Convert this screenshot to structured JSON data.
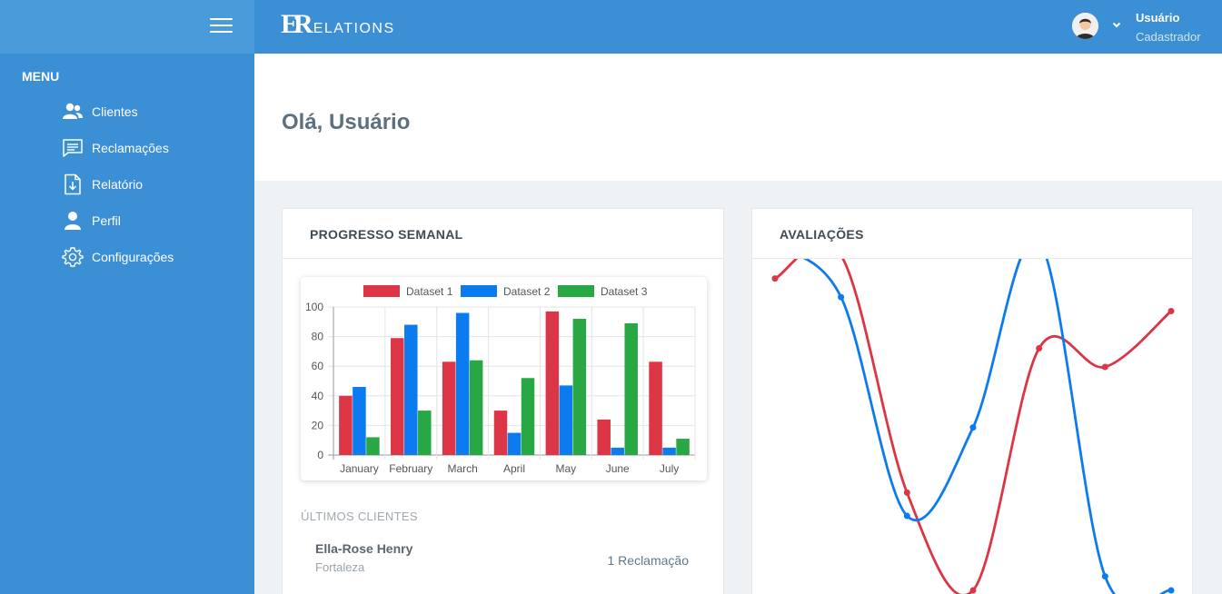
{
  "sidebar": {
    "menu_title": "MENU",
    "items": [
      {
        "label": "Clientes",
        "icon": "users-icon"
      },
      {
        "label": "Reclamações",
        "icon": "message-icon"
      },
      {
        "label": "Relatório",
        "icon": "file-download-icon"
      },
      {
        "label": "Perfil",
        "icon": "user-icon"
      },
      {
        "label": "Configurações",
        "icon": "gear-icon"
      }
    ]
  },
  "header": {
    "logo_mark": "ER",
    "logo_text": "ELATIONS",
    "user_name": "Usuário",
    "user_role": "Cadastrador"
  },
  "greeting": "Olá, Usuário",
  "weekly_card": {
    "title": "PROGRESSO SEMANAL",
    "recent_label": "ÚLTIMOS CLIENTES",
    "client": {
      "name": "Ella-Rose Henry",
      "city": "Fortaleza",
      "complaints": "1 Reclamação"
    }
  },
  "ratings_card": {
    "title": "AVALIAÇÕES"
  },
  "colors": {
    "primary": "#3b8fd4",
    "red": "#dc3545",
    "blue": "#0d7bf0",
    "green": "#28a745"
  },
  "chart_data": [
    {
      "type": "bar",
      "categories": [
        "January",
        "February",
        "March",
        "April",
        "May",
        "June",
        "July"
      ],
      "series": [
        {
          "name": "Dataset 1",
          "color": "#dc3545",
          "values": [
            40,
            79,
            63,
            30,
            97,
            24,
            63
          ]
        },
        {
          "name": "Dataset 2",
          "color": "#0d7bf0",
          "values": [
            46,
            88,
            96,
            15,
            47,
            5,
            5
          ]
        },
        {
          "name": "Dataset 3",
          "color": "#28a745",
          "values": [
            12,
            30,
            64,
            52,
            92,
            89,
            11
          ]
        }
      ],
      "ylim": [
        0,
        100
      ],
      "yticks": [
        0,
        20,
        40,
        60,
        80,
        100
      ],
      "legend": "top",
      "grid": true
    },
    {
      "type": "line",
      "x": [
        1,
        2,
        3,
        4,
        5,
        6,
        7
      ],
      "series": [
        {
          "color": "#dc3545",
          "values": [
            67,
            72,
            21,
            0,
            52,
            48,
            60
          ]
        },
        {
          "color": "#0d7bf0",
          "values": [
            74,
            63,
            16,
            35,
            75,
            3,
            0
          ]
        }
      ],
      "ylim": [
        0,
        80
      ],
      "legend": "none",
      "grid": false
    }
  ]
}
